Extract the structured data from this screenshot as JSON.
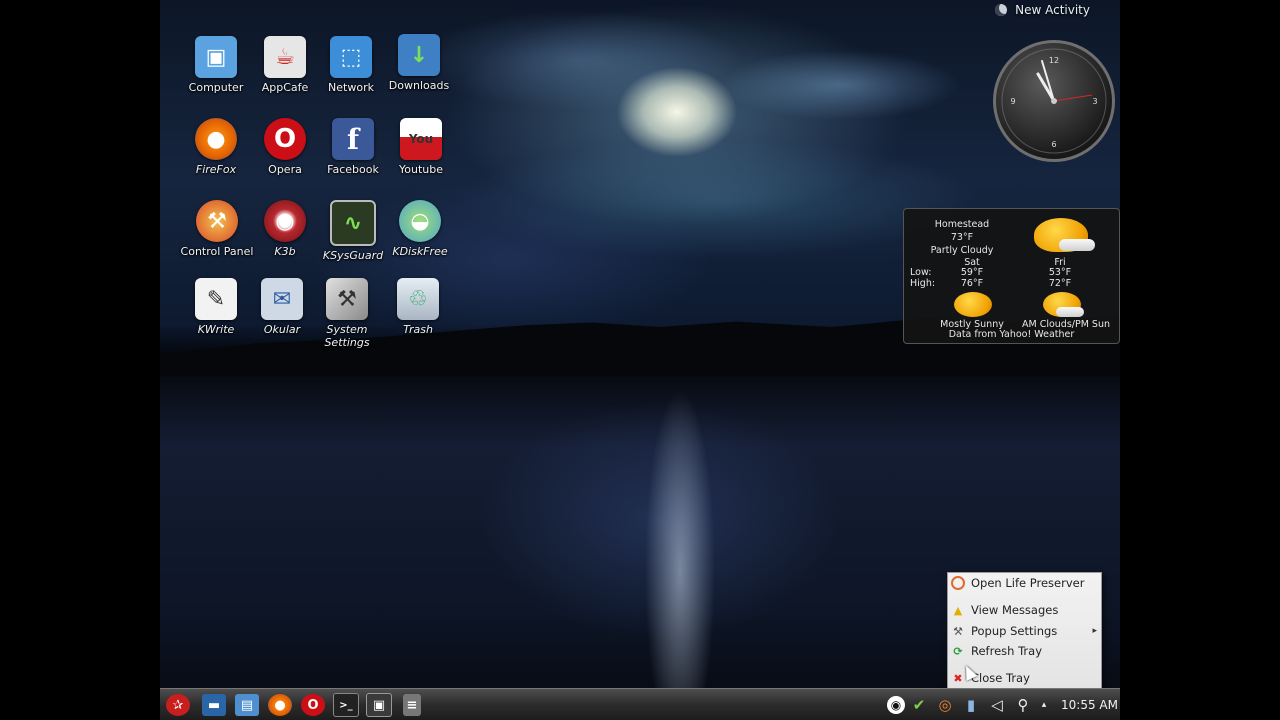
{
  "desktop": {
    "icons": [
      {
        "label": "Computer",
        "icon": "computer-icon",
        "color": "#5ba3e0"
      },
      {
        "label": "AppCafe",
        "icon": "appcafe-icon",
        "color": "#e6e6e6"
      },
      {
        "label": "Network",
        "icon": "network-icon",
        "color": "#3c8ed8"
      },
      {
        "label": "Downloads",
        "icon": "downloads-icon",
        "color": "#3f7fc4"
      },
      {
        "label": "FireFox",
        "icon": "firefox-icon",
        "color": "#e66000"
      },
      {
        "label": "Opera",
        "icon": "opera-icon",
        "color": "#cc0f16"
      },
      {
        "label": "Facebook",
        "icon": "facebook-icon",
        "color": "#3b5998"
      },
      {
        "label": "Youtube",
        "icon": "youtube-icon",
        "color": "#cc181e"
      },
      {
        "label": "Control Panel",
        "icon": "control-panel-icon",
        "color": "#d8452a"
      },
      {
        "label": "K3b",
        "icon": "k3b-icon",
        "color": "#b8282f"
      },
      {
        "label": "KSysGuard",
        "icon": "ksysguard-icon",
        "color": "#4a6f2a"
      },
      {
        "label": "KDiskFree",
        "icon": "kdiskfree-icon",
        "color": "#4ea4c9"
      },
      {
        "label": "KWrite",
        "icon": "kwrite-icon",
        "color": "#f2f2f2"
      },
      {
        "label": "Okular",
        "icon": "okular-icon",
        "color": "#cfd9e6"
      },
      {
        "label": "System\nSettings",
        "icon": "system-settings-icon",
        "color": "#9a9a9a"
      },
      {
        "label": "Trash",
        "icon": "trash-icon",
        "color": "#d0d8e0"
      }
    ],
    "glyphs": {
      "computer": "▣",
      "appcafe": "☕",
      "network": "⬚",
      "downloads": "↓",
      "firefox": "●",
      "opera": "O",
      "facebook": "f",
      "youtube": "You",
      "control_panel": "⚒",
      "k3b": "◉",
      "ksysguard": "∿",
      "kdiskfree": "◒",
      "kwrite": "✎",
      "okular": "✉",
      "system_settings": "⚒",
      "trash": "♲"
    }
  },
  "activity": {
    "label": "New Activity"
  },
  "clock": {
    "ticks": [
      "12",
      "3",
      "6",
      "9"
    ]
  },
  "weather": {
    "location": "Homestead",
    "current_temp": "73°F",
    "condition": "Partly Cloudy",
    "low_label": "Low:",
    "high_label": "High:",
    "days": [
      {
        "day": "Sat",
        "low": "59°F",
        "high": "76°F",
        "forecast": "Mostly Sunny"
      },
      {
        "day": "Fri",
        "low": "53°F",
        "high": "72°F",
        "forecast": "AM Clouds/PM Sun"
      }
    ],
    "source": "Data from Yahoo! Weather"
  },
  "tray_menu": {
    "items": [
      {
        "label": "Open Life Preserver",
        "icon": "life-preserver-icon"
      },
      {
        "label": "View Messages",
        "icon": "warning-icon"
      },
      {
        "label": "Popup Settings",
        "icon": "wrench-icon",
        "submenu": "▸"
      },
      {
        "label": "Refresh Tray",
        "icon": "refresh-icon"
      },
      {
        "label": "Close Tray",
        "icon": "close-icon"
      }
    ]
  },
  "taskbar": {
    "launchers": [
      {
        "name": "kickoff-menu-icon",
        "glyph": "✰",
        "color": "#c81e1e"
      },
      {
        "name": "desktop-icon",
        "glyph": "▬",
        "color": "#2a65a8"
      },
      {
        "name": "file-manager-icon",
        "glyph": "▤",
        "color": "#4f8fd0"
      },
      {
        "name": "firefox-launcher-icon",
        "glyph": "●",
        "color": "#e66000"
      },
      {
        "name": "opera-launcher-icon",
        "glyph": "O",
        "color": "#cc0f16"
      },
      {
        "name": "terminal-icon",
        "glyph": ">_",
        "color": "#222222"
      },
      {
        "name": "monitor-icon",
        "glyph": "▣",
        "color": "#3a3a3a"
      },
      {
        "name": "calculator-icon",
        "glyph": "≡",
        "color": "#777777"
      }
    ],
    "tray": [
      {
        "name": "pcbsd-icon",
        "glyph": "◉"
      },
      {
        "name": "update-icon",
        "glyph": "✔"
      },
      {
        "name": "life-preserver-tray-icon",
        "glyph": "◎"
      },
      {
        "name": "network-tray-icon",
        "glyph": "▮"
      },
      {
        "name": "volume-icon",
        "glyph": "◁"
      },
      {
        "name": "search-tray-icon",
        "glyph": "⚲"
      },
      {
        "name": "tray-expand-icon",
        "glyph": "▴"
      }
    ],
    "time": "10:55 AM"
  }
}
